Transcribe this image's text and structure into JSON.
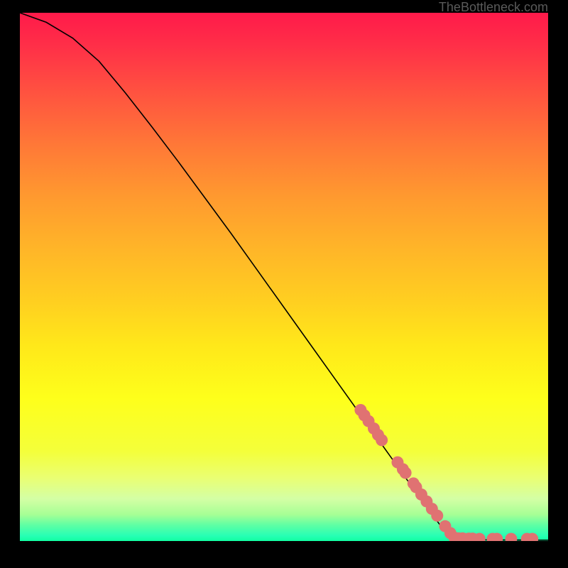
{
  "watermark": "TheBottleneck.com",
  "chart_data": {
    "type": "line",
    "title": "",
    "xlabel": "",
    "ylabel": "",
    "xlim": [
      0,
      100
    ],
    "ylim": [
      0,
      100
    ],
    "curve": [
      {
        "x": 0,
        "y": 100
      },
      {
        "x": 5,
        "y": 98.2
      },
      {
        "x": 10,
        "y": 95.2
      },
      {
        "x": 15,
        "y": 90.8
      },
      {
        "x": 20,
        "y": 84.8
      },
      {
        "x": 25,
        "y": 78.4
      },
      {
        "x": 30,
        "y": 71.8
      },
      {
        "x": 35,
        "y": 65.0
      },
      {
        "x": 40,
        "y": 58.2
      },
      {
        "x": 45,
        "y": 51.2
      },
      {
        "x": 50,
        "y": 44.2
      },
      {
        "x": 55,
        "y": 37.2
      },
      {
        "x": 60,
        "y": 30.2
      },
      {
        "x": 65,
        "y": 23.2
      },
      {
        "x": 70,
        "y": 16.2
      },
      {
        "x": 75,
        "y": 9.2
      },
      {
        "x": 80,
        "y": 2.4
      },
      {
        "x": 82,
        "y": 0.4
      },
      {
        "x": 85,
        "y": 0.25
      },
      {
        "x": 90,
        "y": 0.2
      },
      {
        "x": 95,
        "y": 0.18
      },
      {
        "x": 100,
        "y": 0.16
      }
    ],
    "highlight_points": [
      {
        "x": 64.5,
        "y": 24.8
      },
      {
        "x": 65.2,
        "y": 23.8
      },
      {
        "x": 66.0,
        "y": 22.7
      },
      {
        "x": 67.0,
        "y": 21.3
      },
      {
        "x": 67.8,
        "y": 20.1
      },
      {
        "x": 68.5,
        "y": 19.1
      },
      {
        "x": 71.5,
        "y": 14.9
      },
      {
        "x": 72.5,
        "y": 13.6
      },
      {
        "x": 73.0,
        "y": 12.9
      },
      {
        "x": 74.5,
        "y": 10.9
      },
      {
        "x": 75.0,
        "y": 10.2
      },
      {
        "x": 76.0,
        "y": 8.8
      },
      {
        "x": 77.0,
        "y": 7.5
      },
      {
        "x": 78.0,
        "y": 6.1
      },
      {
        "x": 79.0,
        "y": 4.8
      },
      {
        "x": 80.5,
        "y": 2.8
      },
      {
        "x": 81.5,
        "y": 1.5
      },
      {
        "x": 82.3,
        "y": 0.6
      },
      {
        "x": 83.0,
        "y": 0.5
      },
      {
        "x": 83.8,
        "y": 0.5
      },
      {
        "x": 85.0,
        "y": 0.45
      },
      {
        "x": 85.7,
        "y": 0.45
      },
      {
        "x": 87.0,
        "y": 0.4
      },
      {
        "x": 89.5,
        "y": 0.4
      },
      {
        "x": 90.3,
        "y": 0.4
      },
      {
        "x": 93.0,
        "y": 0.4
      },
      {
        "x": 96.0,
        "y": 0.4
      },
      {
        "x": 97.0,
        "y": 0.4
      }
    ],
    "highlight_color": "#e07272",
    "highlight_radius": 8.5
  }
}
